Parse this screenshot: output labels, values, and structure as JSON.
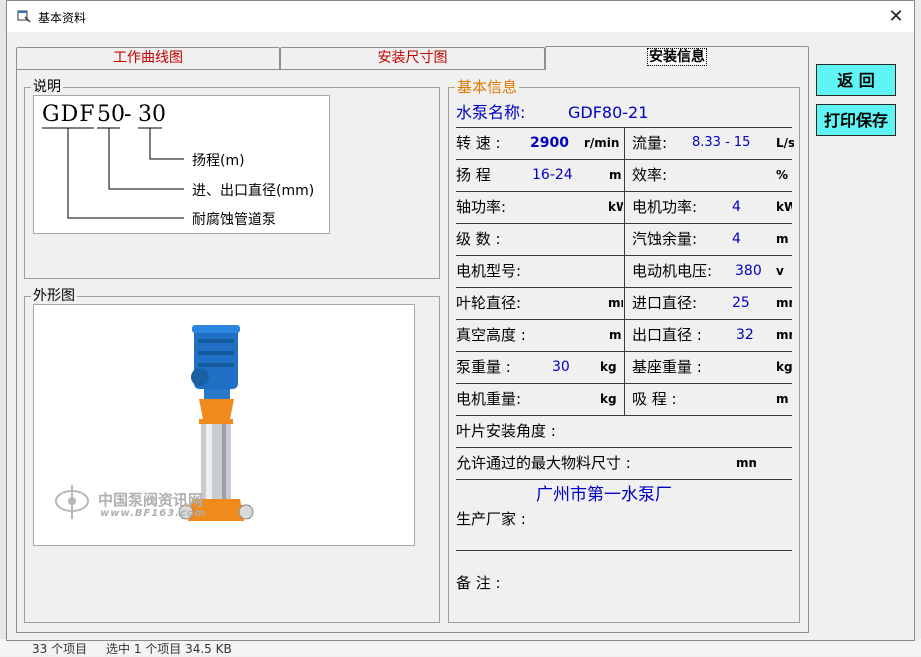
{
  "window": {
    "title": "基本资料",
    "close_glyph": "✕"
  },
  "background": {
    "status_count": "33 个项目",
    "status_selected": "选中 1 个项目  34.5 KB"
  },
  "tabs": [
    {
      "label": "工作曲线图"
    },
    {
      "label": "安装尺寸图"
    },
    {
      "label": "安装信息"
    }
  ],
  "buttons": {
    "back": "返  回",
    "print_save": "打印保存"
  },
  "description": {
    "legend": "说明",
    "code_part1": "GDF",
    "code_part2": "50",
    "code_dash": "-",
    "code_part3": "30",
    "note_head": "扬程(m)",
    "note_diameter": "进、出口直径(mm)",
    "note_type": "耐腐蚀管道泵"
  },
  "exterior": {
    "legend": "外形图",
    "watermark_cn": "中国泵阀资讯网",
    "watermark_url": "www.BF163.com"
  },
  "info": {
    "legend": "基本信息",
    "pump_name_label": "水泵名称:",
    "pump_name_value": "GDF80-21",
    "speed_label": "转  速 :",
    "speed_value": "2900",
    "speed_unit": "r/min",
    "flow_label": "流量:",
    "flow_value": "8.33 - 15",
    "flow_unit": "L/s",
    "head_label": "扬  程",
    "head_value": "16-24",
    "head_unit": "m",
    "efficiency_label": "效率:",
    "efficiency_value": "",
    "efficiency_unit": "%",
    "shaft_power_label": "轴功率:",
    "shaft_power_unit": "kW",
    "motor_power_label": "电机功率:",
    "motor_power_value": "4",
    "motor_power_unit": "kW",
    "stages_label": "级  数 :",
    "npsh_label": "汽蚀余量:",
    "npsh_value": "4",
    "npsh_unit": "m",
    "motor_model_label": "电机型号:",
    "motor_voltage_label": "电动机电压:",
    "motor_voltage_value": "380",
    "motor_voltage_unit": "v",
    "impeller_dia_label": "叶轮直径:",
    "impeller_dia_unit": "mm",
    "inlet_dia_label": "进口直径:",
    "inlet_dia_value": "25",
    "inlet_dia_unit": "mm",
    "vacuum_label": "真空高度  :",
    "vacuum_unit": "m",
    "outlet_dia_label": "出口直径  :",
    "outlet_dia_value": "32",
    "outlet_dia_unit": "mm",
    "pump_weight_label": "泵重量  :",
    "pump_weight_value": "30",
    "pump_weight_unit": "kg",
    "base_weight_label": "基座重量  :",
    "base_weight_unit": "kg",
    "motor_weight_label": "电机重量:",
    "motor_weight_unit": "kg",
    "suction_label": "吸  程  :",
    "suction_unit": "m",
    "blade_angle_label": "叶片安装角度  :",
    "max_particle_label": "允许通过的最大物料尺寸  :",
    "max_particle_unit": "mm",
    "manufacturer_value": "广州市第一水泵厂",
    "manufacturer_label": "生产厂家  :",
    "remarks_label": "备  注  :"
  },
  "colors": {
    "tab_text": "#c00000",
    "value_text": "#0000c0",
    "legend_orange": "#e07800",
    "button_bg": "#5ff5f5"
  }
}
